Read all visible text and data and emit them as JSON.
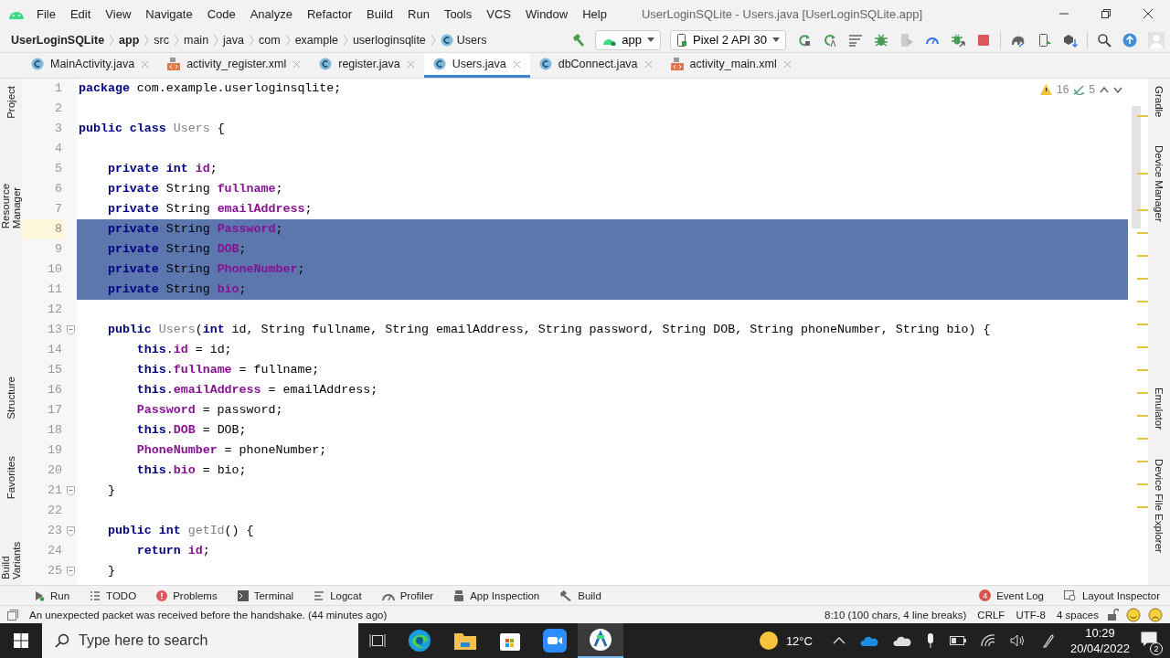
{
  "window": {
    "title": "UserLoginSQLite - Users.java [UserLoginSQLite.app]"
  },
  "menu": [
    "File",
    "Edit",
    "View",
    "Navigate",
    "Code",
    "Analyze",
    "Refactor",
    "Build",
    "Run",
    "Tools",
    "VCS",
    "Window",
    "Help"
  ],
  "breadcrumbs": [
    {
      "label": "UserLoginSQLite",
      "bold": true
    },
    {
      "label": "app",
      "bold": true
    },
    {
      "label": "src",
      "bold": false
    },
    {
      "label": "main",
      "bold": false
    },
    {
      "label": "java",
      "bold": false
    },
    {
      "label": "com",
      "bold": false
    },
    {
      "label": "example",
      "bold": false
    },
    {
      "label": "userloginsqlite",
      "bold": false
    },
    {
      "label": "Users",
      "bold": false
    }
  ],
  "run_config": "app",
  "device": "Pixel 2 API 30",
  "tabs": [
    {
      "label": "MainActivity.java",
      "kind": "class",
      "selected": false
    },
    {
      "label": "activity_register.xml",
      "kind": "xml",
      "selected": false
    },
    {
      "label": "register.java",
      "kind": "class",
      "selected": false
    },
    {
      "label": "Users.java",
      "kind": "class",
      "selected": true
    },
    {
      "label": "dbConnect.java",
      "kind": "class",
      "selected": false
    },
    {
      "label": "activity_main.xml",
      "kind": "xml",
      "selected": false
    }
  ],
  "left_tools": [
    "Project",
    "Resource Manager",
    "Structure",
    "Favorites",
    "Build Variants"
  ],
  "right_tools": [
    "Gradle",
    "Device Manager",
    "Emulator",
    "Device File Explorer"
  ],
  "inspections": {
    "warnings": "16",
    "typos": "5"
  },
  "code": [
    {
      "number": "1",
      "selected": false,
      "current": false,
      "fold": false,
      "tokens": [
        {
          "kind": "kw",
          "t": "package "
        },
        {
          "kind": "text",
          "t": "com.example.userloginsqlite;"
        }
      ]
    },
    {
      "number": "2",
      "selected": false,
      "current": false,
      "fold": false
    },
    {
      "number": "3",
      "selected": false,
      "current": false,
      "fold": false,
      "tokens": [
        {
          "kind": "kw",
          "t": "public class "
        },
        {
          "kind": "unused",
          "t": "Users "
        },
        {
          "kind": "text",
          "t": "{"
        }
      ]
    },
    {
      "number": "4",
      "selected": false,
      "current": false,
      "fold": false
    },
    {
      "number": "5",
      "selected": false,
      "current": false,
      "fold": false,
      "tokens": [
        {
          "kind": "kw",
          "t": "    private int "
        },
        {
          "kind": "field",
          "t": "id"
        },
        {
          "kind": "text",
          "t": ";"
        }
      ]
    },
    {
      "number": "6",
      "selected": false,
      "current": false,
      "fold": false,
      "tokens": [
        {
          "kind": "kw",
          "t": "    private "
        },
        {
          "kind": "text",
          "t": "String "
        },
        {
          "kind": "field",
          "t": "fullname"
        },
        {
          "kind": "text",
          "t": ";"
        }
      ]
    },
    {
      "number": "7",
      "selected": false,
      "current": false,
      "fold": false,
      "tokens": [
        {
          "kind": "kw",
          "t": "    private "
        },
        {
          "kind": "text",
          "t": "String "
        },
        {
          "kind": "field",
          "t": "emailAddress"
        },
        {
          "kind": "text",
          "t": ";"
        }
      ]
    },
    {
      "number": "8",
      "selected": true,
      "current": true,
      "fold": false,
      "tokens": [
        {
          "kind": "kw",
          "t": "    private "
        },
        {
          "kind": "text",
          "t": "String "
        },
        {
          "kind": "field",
          "t": "Password"
        },
        {
          "kind": "text",
          "t": ";"
        }
      ]
    },
    {
      "number": "9",
      "selected": true,
      "current": false,
      "fold": false,
      "tokens": [
        {
          "kind": "kw",
          "t": "    private "
        },
        {
          "kind": "text",
          "t": "String "
        },
        {
          "kind": "field",
          "t": "DOB"
        },
        {
          "kind": "text",
          "t": ";"
        }
      ]
    },
    {
      "number": "10",
      "selected": true,
      "current": false,
      "fold": false,
      "tokens": [
        {
          "kind": "kw",
          "t": "    private "
        },
        {
          "kind": "text",
          "t": "String "
        },
        {
          "kind": "field",
          "t": "PhoneNumber"
        },
        {
          "kind": "text",
          "t": ";"
        }
      ]
    },
    {
      "number": "11",
      "selected": true,
      "current": false,
      "fold": false,
      "tokens": [
        {
          "kind": "kw",
          "t": "    private "
        },
        {
          "kind": "text",
          "t": "String "
        },
        {
          "kind": "field",
          "t": "bio"
        },
        {
          "kind": "text",
          "t": ";"
        }
      ]
    },
    {
      "number": "12",
      "selected": false,
      "current": false,
      "fold": false
    },
    {
      "number": "13",
      "selected": false,
      "current": false,
      "fold": true,
      "tokens": [
        {
          "kind": "kw",
          "t": "    public "
        },
        {
          "kind": "unused",
          "t": "Users"
        },
        {
          "kind": "text",
          "t": "("
        },
        {
          "kind": "kw",
          "t": "int "
        },
        {
          "kind": "text",
          "t": "id, String fullname, String emailAddress, String password, String DOB, String phoneNumber, String bio) {"
        }
      ]
    },
    {
      "number": "14",
      "selected": false,
      "current": false,
      "fold": false,
      "tokens": [
        {
          "kind": "kw",
          "t": "        this"
        },
        {
          "kind": "text",
          "t": "."
        },
        {
          "kind": "field",
          "t": "id"
        },
        {
          "kind": "text",
          "t": " = id;"
        }
      ]
    },
    {
      "number": "15",
      "selected": false,
      "current": false,
      "fold": false,
      "tokens": [
        {
          "kind": "kw",
          "t": "        this"
        },
        {
          "kind": "text",
          "t": "."
        },
        {
          "kind": "field",
          "t": "fullname"
        },
        {
          "kind": "text",
          "t": " = fullname;"
        }
      ]
    },
    {
      "number": "16",
      "selected": false,
      "current": false,
      "fold": false,
      "tokens": [
        {
          "kind": "kw",
          "t": "        this"
        },
        {
          "kind": "text",
          "t": "."
        },
        {
          "kind": "field",
          "t": "emailAddress"
        },
        {
          "kind": "text",
          "t": " = emailAddress;"
        }
      ]
    },
    {
      "number": "17",
      "selected": false,
      "current": false,
      "fold": false,
      "tokens": [
        {
          "kind": "field",
          "t": "        Password"
        },
        {
          "kind": "text",
          "t": " = password;"
        }
      ]
    },
    {
      "number": "18",
      "selected": false,
      "current": false,
      "fold": false,
      "tokens": [
        {
          "kind": "kw",
          "t": "        this"
        },
        {
          "kind": "text",
          "t": "."
        },
        {
          "kind": "field",
          "t": "DOB"
        },
        {
          "kind": "text",
          "t": " = DOB;"
        }
      ]
    },
    {
      "number": "19",
      "selected": false,
      "current": false,
      "fold": false,
      "tokens": [
        {
          "kind": "field",
          "t": "        PhoneNumber"
        },
        {
          "kind": "text",
          "t": " = phoneNumber;"
        }
      ]
    },
    {
      "number": "20",
      "selected": false,
      "current": false,
      "fold": false,
      "tokens": [
        {
          "kind": "kw",
          "t": "        this"
        },
        {
          "kind": "text",
          "t": "."
        },
        {
          "kind": "field",
          "t": "bio"
        },
        {
          "kind": "text",
          "t": " = bio;"
        }
      ]
    },
    {
      "number": "21",
      "selected": false,
      "current": false,
      "fold": true,
      "tokens": [
        {
          "kind": "text",
          "t": "    }"
        }
      ]
    },
    {
      "number": "22",
      "selected": false,
      "current": false,
      "fold": false
    },
    {
      "number": "23",
      "selected": false,
      "current": false,
      "fold": true,
      "tokens": [
        {
          "kind": "kw",
          "t": "    public int "
        },
        {
          "kind": "unused",
          "t": "getId"
        },
        {
          "kind": "text",
          "t": "() {"
        }
      ]
    },
    {
      "number": "24",
      "selected": false,
      "current": false,
      "fold": false,
      "tokens": [
        {
          "kind": "kw",
          "t": "        return "
        },
        {
          "kind": "field",
          "t": "id"
        },
        {
          "kind": "text",
          "t": ";"
        }
      ]
    },
    {
      "number": "25",
      "selected": false,
      "current": false,
      "fold": true,
      "tokens": [
        {
          "kind": "text",
          "t": "    }"
        }
      ]
    }
  ],
  "tool_windows": [
    {
      "label": "Run",
      "kind": "run"
    },
    {
      "label": "TODO",
      "kind": "todo"
    },
    {
      "label": "Problems",
      "kind": "problems"
    },
    {
      "label": "Terminal",
      "kind": "terminal"
    },
    {
      "label": "Logcat",
      "kind": "logcat"
    },
    {
      "label": "Profiler",
      "kind": "profiler"
    },
    {
      "label": "App Inspection",
      "kind": "inspection"
    },
    {
      "label": "Build",
      "kind": "build"
    }
  ],
  "event_log": {
    "label": "Event Log",
    "count": "4"
  },
  "layout_inspector": "Layout Inspector",
  "status_message": "An unexpected packet was received before the handshake. (44 minutes ago)",
  "status_items": [
    "8:10 (100 chars, 4 line breaks)",
    "CRLF",
    "UTF-8",
    "4 spaces"
  ],
  "taskbar": {
    "search_placeholder": "Type here to search",
    "temperature": "12°C",
    "time": "10:29",
    "date": "20/04/2022",
    "notifications": "2"
  }
}
